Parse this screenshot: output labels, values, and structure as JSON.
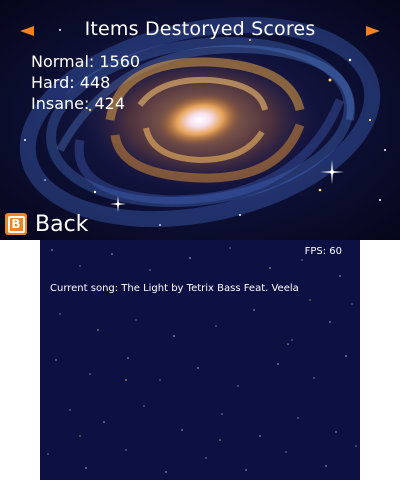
{
  "top_screen": {
    "title": "Items Destoryed Scores",
    "scores": [
      {
        "label": "Normal: 1560"
      },
      {
        "label": "Hard: 448"
      },
      {
        "label": "Insane: 424"
      }
    ],
    "back_button": {
      "icon_letter": "B",
      "label": "Back"
    },
    "nav_icons": {
      "left": "arrow-left-icon",
      "right": "arrow-right-icon"
    }
  },
  "bottom_screen": {
    "fps": "FPS: 60",
    "current_song": "Current song: The Light by Tetrix Bass Feat. Veela"
  },
  "colors": {
    "accent": "#f5811f",
    "bottom_background": "#0c1043",
    "text": "#ffffff"
  }
}
